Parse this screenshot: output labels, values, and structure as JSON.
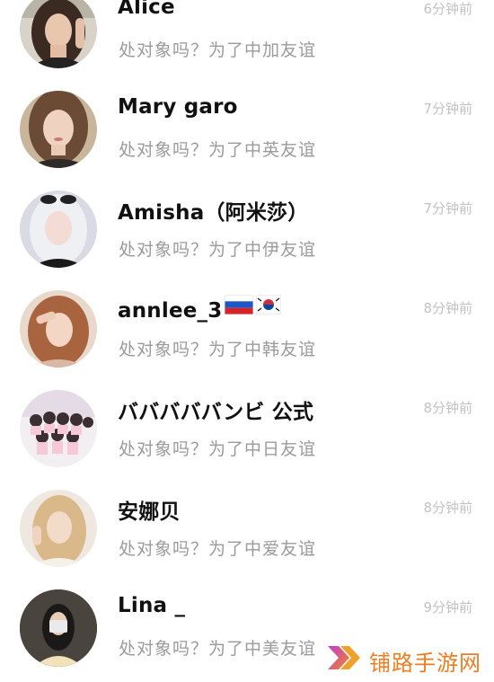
{
  "chats": [
    {
      "name": "Alice",
      "message": "处对象吗？为了中加友谊",
      "time": "6分钟前",
      "avatar": "avatar-dark-hair-woman"
    },
    {
      "name": "Mary garo",
      "message": "处对象吗？为了中英友谊",
      "time": "7分钟前",
      "avatar": "avatar-brunette-woman"
    },
    {
      "name": "Amisha（阿米莎）",
      "message": "处对象吗？为了中伊友谊",
      "time": "7分钟前",
      "avatar": "avatar-white-hair-woman"
    },
    {
      "name": "annlee_3",
      "message": "处对象吗？为了中韩友谊",
      "time": "8分钟前",
      "avatar": "avatar-auburn-hair-woman",
      "flags": [
        "russia-flag-icon",
        "korea-flag-icon"
      ]
    },
    {
      "name": "バババババンビ 公式",
      "message": "处对象吗？为了中日友谊",
      "time": "8分钟前",
      "avatar": "avatar-group-photo"
    },
    {
      "name": "安娜贝",
      "message": "处对象吗？为了中爱友谊",
      "time": "8分钟前",
      "avatar": "avatar-blonde-woman"
    },
    {
      "name": "Lina _",
      "message": "处对象吗？为了中美友谊",
      "time": "9分钟前",
      "avatar": "avatar-mirror-selfie"
    }
  ],
  "watermark": {
    "text": "铺路手游网",
    "logo": "double-chevron-logo-icon",
    "color": "#ee7d22"
  }
}
